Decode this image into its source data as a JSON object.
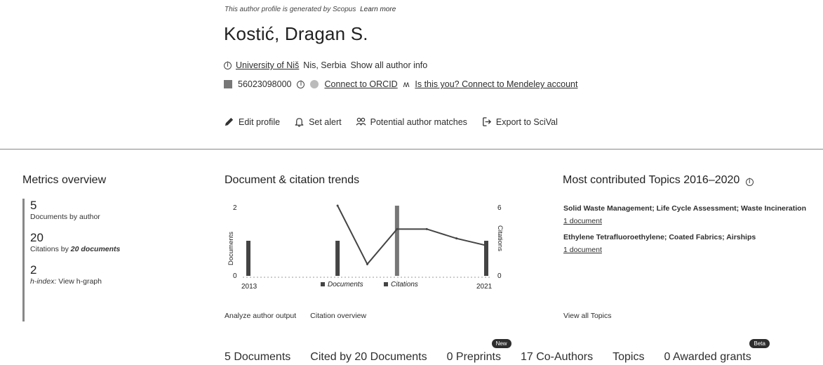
{
  "header": {
    "generated_note": "This author profile is generated by Scopus",
    "learn_more": "Learn more",
    "author_name": "Kostić, Dragan S.",
    "university": "University of Niš",
    "location": "Nis, Serbia",
    "show_all": "Show all author info",
    "author_id": "56023098000",
    "orcid_link": "Connect to ORCID",
    "mendeley_link": "Is this you? Connect to Mendeley account"
  },
  "actions": {
    "edit": "Edit profile",
    "alert": "Set alert",
    "matches": "Potential author matches",
    "export": "Export to SciVal"
  },
  "metrics": {
    "title": "Metrics overview",
    "docs_value": "5",
    "docs_label": "Documents by author",
    "cites_value": "20",
    "cites_label_pre": "Citations by",
    "cites_label_num": "20 documents",
    "h_value": "2",
    "h_label": "h-index:",
    "h_link": "View h-graph"
  },
  "trends": {
    "title": "Document & citation trends",
    "analyze": "Analyze author output",
    "citation_overview": "Citation overview"
  },
  "chart_data": {
    "type": "bar+line",
    "x": [
      2013,
      2014,
      2015,
      2016,
      2017,
      2018,
      2019,
      2020,
      2021
    ],
    "x_tick_labels": [
      "2013",
      "2021"
    ],
    "series": [
      {
        "name": "Documents",
        "kind": "bar",
        "axis": "left",
        "values": [
          1,
          0,
          0,
          1,
          0,
          2,
          0,
          0,
          1
        ]
      },
      {
        "name": "Citations",
        "kind": "line",
        "axis": "right",
        "values": [
          null,
          null,
          null,
          6,
          1,
          4,
          4,
          3.2,
          2.6
        ]
      }
    ],
    "ylabel_left": "Documents",
    "ylabel_right": "Citations",
    "ylim_left": [
      0,
      2
    ],
    "ylim_right": [
      0,
      6
    ],
    "left_ticks": [
      "2",
      "0"
    ],
    "right_ticks": [
      "6",
      "0"
    ],
    "colors": {
      "documents": "#444444",
      "citations": "#444444"
    }
  },
  "topics": {
    "title": "Most contributed Topics 2016–2020",
    "items": [
      {
        "name": "Solid Waste Management; Life Cycle Assessment; Waste Incineration",
        "docs": "1 document"
      },
      {
        "name": "Ethylene Tetrafluoroethylene; Coated Fabrics; Airships",
        "docs": "1 document"
      }
    ],
    "view_all": "View all Topics"
  },
  "tabs": [
    {
      "label": "5 Documents"
    },
    {
      "label": "Cited by 20 Documents"
    },
    {
      "label": "0 Preprints",
      "badge": "New"
    },
    {
      "label": "17 Co-Authors"
    },
    {
      "label": "Topics"
    },
    {
      "label": "0 Awarded grants",
      "badge": "Beta"
    }
  ]
}
